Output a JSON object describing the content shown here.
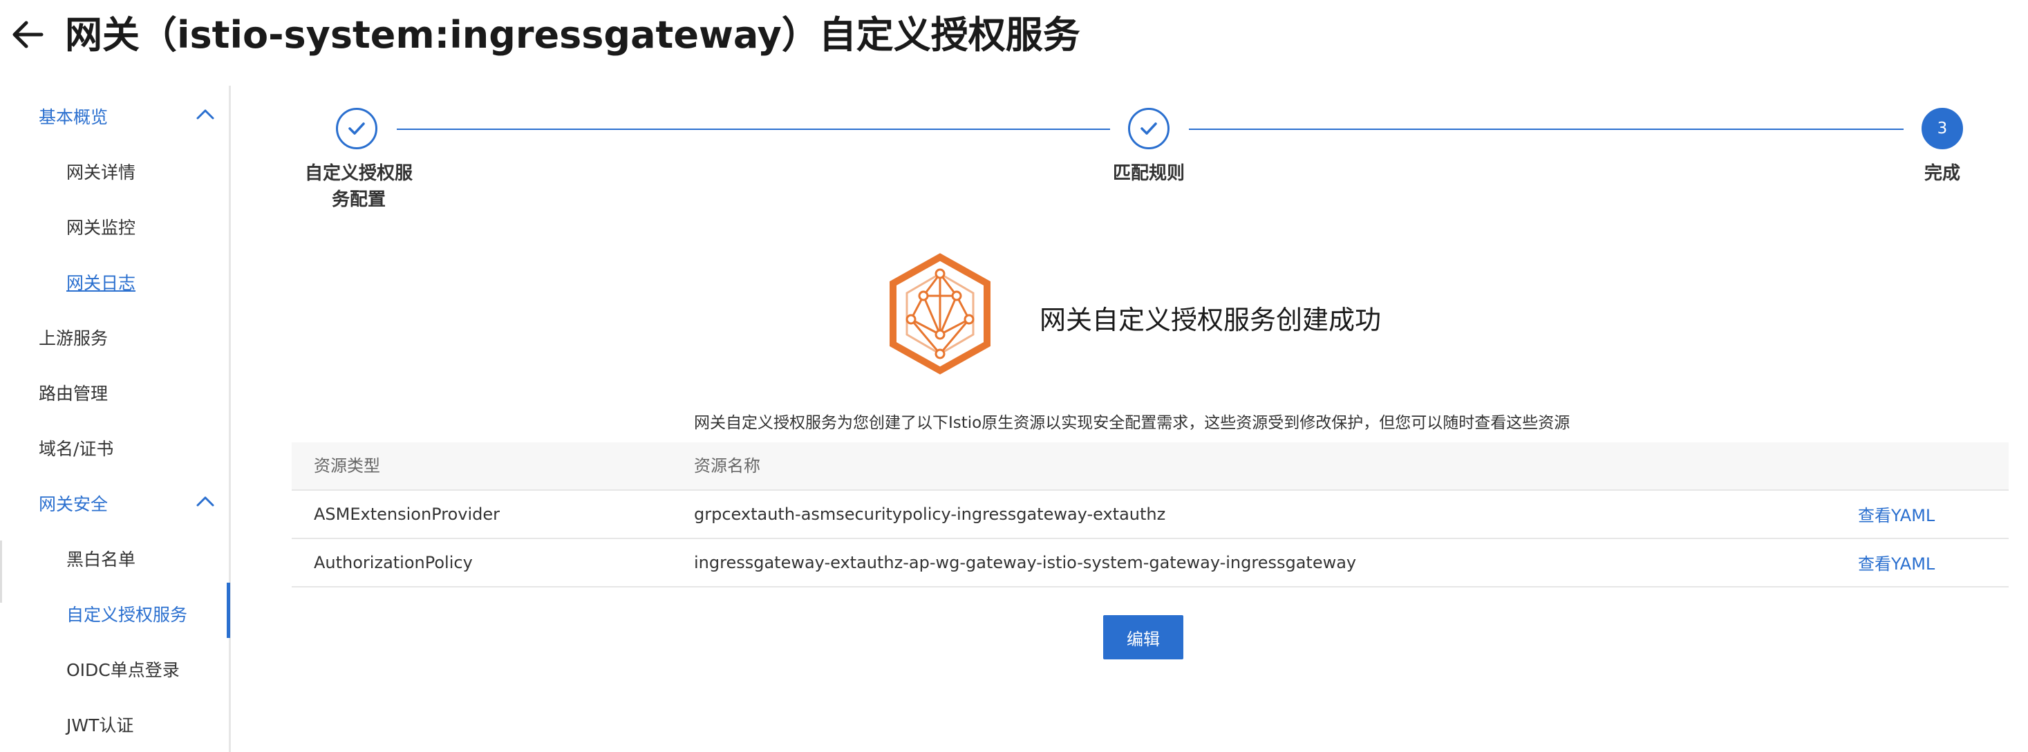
{
  "header": {
    "title": "网关（istio-system:ingressgateway）自定义授权服务",
    "back_icon": "arrow-left-icon"
  },
  "sidebar": {
    "groups": [
      {
        "label": "基本概览",
        "expanded": true
      },
      {
        "label": "网关安全",
        "expanded": true
      }
    ],
    "items": [
      {
        "label": "网关详情"
      },
      {
        "label": "网关监控"
      },
      {
        "label": "网关日志"
      },
      {
        "label": "上游服务"
      },
      {
        "label": "路由管理"
      },
      {
        "label": "域名/证书"
      },
      {
        "label": "黑白名单"
      },
      {
        "label": "自定义授权服务",
        "active": true
      },
      {
        "label": "OIDC单点登录"
      },
      {
        "label": "JWT认证"
      }
    ]
  },
  "steps": [
    {
      "label": "自定义授权服\n务配置",
      "status": "done"
    },
    {
      "label": "匹配规则",
      "status": "done"
    },
    {
      "label": "完成",
      "number": "3",
      "status": "current"
    }
  ],
  "result": {
    "title": "网关自定义授权服务创建成功",
    "notice": "网关自定义授权服务为您创建了以下Istio原生资源以实现安全配置需求，这些资源受到修改保护，但您可以随时查看这些资源",
    "icon": "network-hexagon-icon"
  },
  "table": {
    "columns": [
      "资源类型",
      "资源名称"
    ],
    "rows": [
      {
        "type": "ASMExtensionProvider",
        "name": "grpcextauth-asmsecuritypolicy-ingressgateway-extauthz",
        "action": "查看YAML"
      },
      {
        "type": "AuthorizationPolicy",
        "name": "ingressgateway-extauthz-ap-wg-gateway-istio-system-gateway-ingressgateway",
        "action": "查看YAML"
      }
    ]
  },
  "actions": {
    "edit_label": "编辑"
  },
  "colors": {
    "accent": "#2a6fcf",
    "logo": "#e8762f"
  }
}
